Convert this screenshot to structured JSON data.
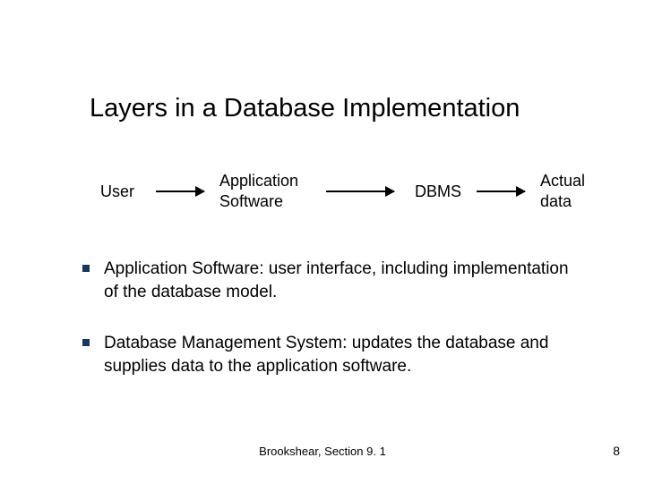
{
  "title": "Layers in a Database Implementation",
  "diagram": {
    "nodes": {
      "user": "User",
      "appsoft_line1": "Application",
      "appsoft_line2": "Software",
      "dbms": "DBMS",
      "actual_line1": "Actual",
      "actual_line2": "data"
    }
  },
  "bullets": [
    "Application Software: user interface, including implementation of the database model.",
    "Database Management System: updates the database and supplies data to the application software."
  ],
  "footer": "Brookshear, Section 9. 1",
  "page": "8"
}
